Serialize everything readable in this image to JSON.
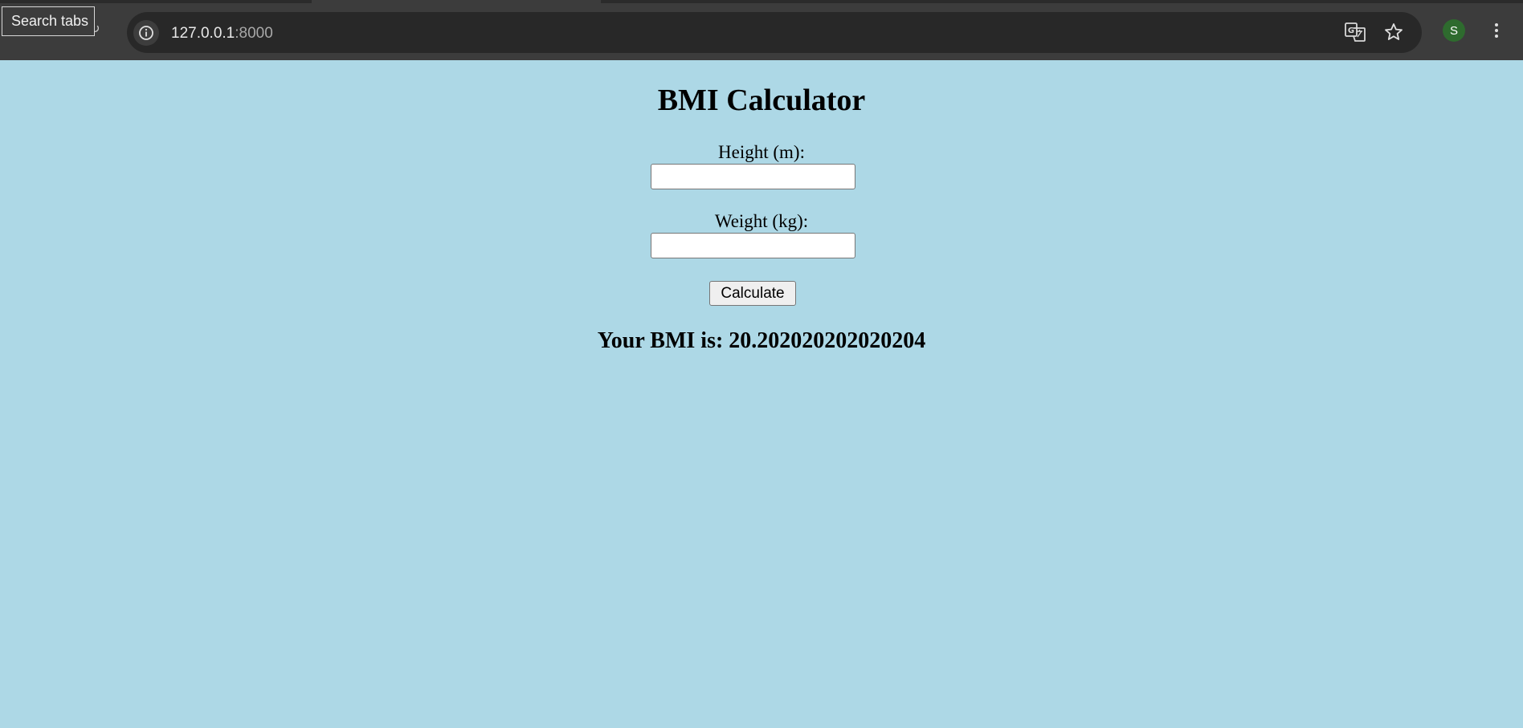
{
  "browser": {
    "tooltip": "Search tabs",
    "url_host": "127.0.0.1",
    "url_port": ":8000",
    "profile_initial": "S",
    "icons": {
      "back": "arrow-left-icon",
      "forward": "arrow-right-icon",
      "reload": "reload-icon",
      "site_info": "info-icon",
      "translate": "translate-icon",
      "bookmark": "star-icon",
      "menu": "kebab-menu-icon"
    }
  },
  "page": {
    "title": "BMI Calculator",
    "height_label": "Height (m):",
    "height_value": "",
    "weight_label": "Weight (kg):",
    "weight_value": "",
    "calculate_label": "Calculate",
    "result_text": "Your BMI is: 20.202020202020204"
  },
  "colors": {
    "page_background": "#add8e6",
    "chrome_background": "#3c3c3c",
    "omnibox_background": "#282828",
    "avatar_background": "#2e6b2e"
  }
}
